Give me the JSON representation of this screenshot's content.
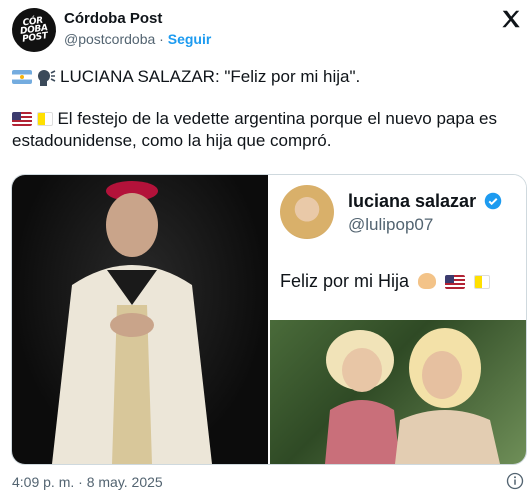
{
  "account": {
    "name": "Córdoba Post",
    "handle": "@postcordoba",
    "separator": "·",
    "follow_label": "Seguir",
    "avatar_text": "CÓR DOBA POST"
  },
  "tweet": {
    "line1_text": "LUCIANA SALAZAR: \"Feliz por mi hija\".",
    "line2_text": "El festejo de la vedette argentina porque el nuevo papa es estadounidense, como la hija que compró."
  },
  "embedded_post": {
    "name": "luciana salazar",
    "handle": "@lulipop07",
    "text": "Feliz por mi Hija"
  },
  "timestamp": "4:09 p. m. · 8 may. 2025",
  "icons": [
    "x-logo-icon",
    "argentina-flag-icon",
    "speaking-head-icon",
    "us-flag-icon",
    "vatican-flag-icon",
    "verified-badge-icon",
    "clapping-hands-icon",
    "info-icon"
  ],
  "colors": {
    "accent": "#1d9bf0",
    "text": "#0f1419",
    "muted": "#536471",
    "border": "#cfd9de"
  }
}
